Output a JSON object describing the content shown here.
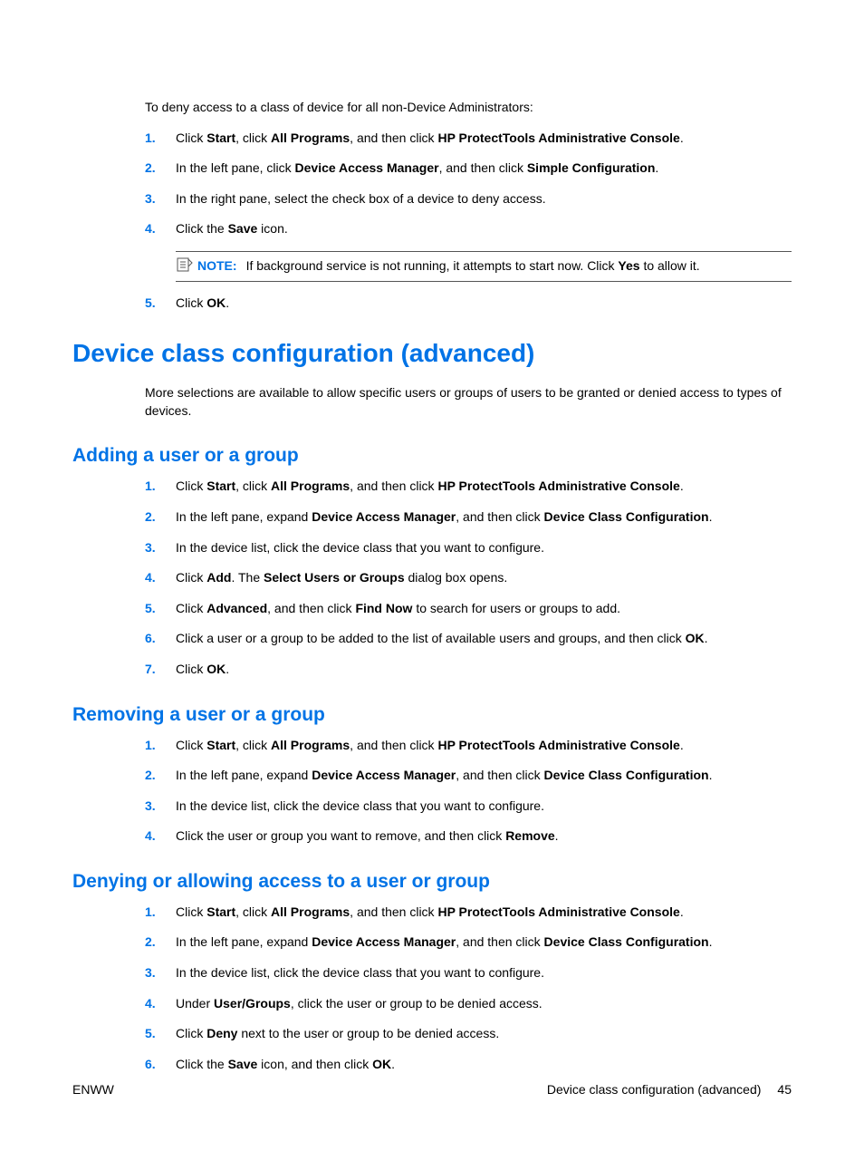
{
  "intro": "To deny access to a class of device for all non-Device Administrators:",
  "steps1": {
    "s1": {
      "pre": "Click ",
      "b1": "Start",
      "mid1": ", click ",
      "b2": "All Programs",
      "mid2": ", and then click ",
      "b3": "HP ProtectTools Administrative Console",
      "post": "."
    },
    "s2": {
      "pre": "In the left pane, click ",
      "b1": "Device Access Manager",
      "mid1": ", and then click ",
      "b2": "Simple Configuration",
      "post": "."
    },
    "s3": "In the right pane, select the check box of a device to deny access.",
    "s4": {
      "pre": "Click the ",
      "b1": "Save",
      "post": " icon."
    },
    "note_label": "NOTE:",
    "note_text_pre": "If background service is not running, it attempts to start now. Click ",
    "note_text_b": "Yes",
    "note_text_post": " to allow it.",
    "s5": {
      "pre": "Click ",
      "b1": "OK",
      "post": "."
    }
  },
  "h1": "Device class configuration (advanced)",
  "h1_para": "More selections are available to allow specific users or groups of users to be granted or denied access to types of devices.",
  "h2a": "Adding a user or a group",
  "stepsA": {
    "s1": {
      "pre": "Click ",
      "b1": "Start",
      "mid1": ", click ",
      "b2": "All Programs",
      "mid2": ", and then click ",
      "b3": "HP ProtectTools Administrative Console",
      "post": "."
    },
    "s2": {
      "pre": "In the left pane, expand ",
      "b1": "Device Access Manager",
      "mid1": ", and then click ",
      "b2": "Device Class Configuration",
      "post": "."
    },
    "s3": "In the device list, click the device class that you want to configure.",
    "s4": {
      "pre": "Click ",
      "b1": "Add",
      "mid1": ". The ",
      "b2": "Select Users or Groups",
      "post": " dialog box opens."
    },
    "s5": {
      "pre": "Click ",
      "b1": "Advanced",
      "mid1": ", and then click ",
      "b2": "Find Now",
      "post": " to search for users or groups to add."
    },
    "s6": {
      "pre": "Click a user or a group to be added to the list of available users and groups, and then click ",
      "b1": "OK",
      "post": "."
    },
    "s7": {
      "pre": "Click ",
      "b1": "OK",
      "post": "."
    }
  },
  "h2b": "Removing a user or a group",
  "stepsB": {
    "s1": {
      "pre": "Click ",
      "b1": "Start",
      "mid1": ", click ",
      "b2": "All Programs",
      "mid2": ", and then click ",
      "b3": "HP ProtectTools Administrative Console",
      "post": "."
    },
    "s2": {
      "pre": "In the left pane, expand ",
      "b1": "Device Access Manager",
      "mid1": ", and then click ",
      "b2": "Device Class Configuration",
      "post": "."
    },
    "s3": "In the device list, click the device class that you want to configure.",
    "s4": {
      "pre": "Click the user or group you want to remove, and then click ",
      "b1": "Remove",
      "post": "."
    }
  },
  "h2c": "Denying or allowing access to a user or group",
  "stepsC": {
    "s1": {
      "pre": "Click ",
      "b1": "Start",
      "mid1": ", click ",
      "b2": "All Programs",
      "mid2": ", and then click ",
      "b3": "HP ProtectTools Administrative Console",
      "post": "."
    },
    "s2": {
      "pre": "In the left pane, expand ",
      "b1": "Device Access Manager",
      "mid1": ", and then click ",
      "b2": "Device Class Configuration",
      "post": "."
    },
    "s3": "In the device list, click the device class that you want to configure.",
    "s4": {
      "pre": "Under ",
      "b1": "User/Groups",
      "post": ", click the user or group to be denied access."
    },
    "s5": {
      "pre": "Click ",
      "b1": "Deny",
      "post": " next to the user or group to be denied access."
    },
    "s6": {
      "pre": "Click the ",
      "b1": "Save",
      "mid1": " icon, and then click ",
      "b2": "OK",
      "post": "."
    }
  },
  "footer": {
    "left": "ENWW",
    "right_text": "Device class configuration (advanced)",
    "page_num": "45"
  },
  "nums": {
    "n1": "1.",
    "n2": "2.",
    "n3": "3.",
    "n4": "4.",
    "n5": "5.",
    "n6": "6.",
    "n7": "7."
  }
}
